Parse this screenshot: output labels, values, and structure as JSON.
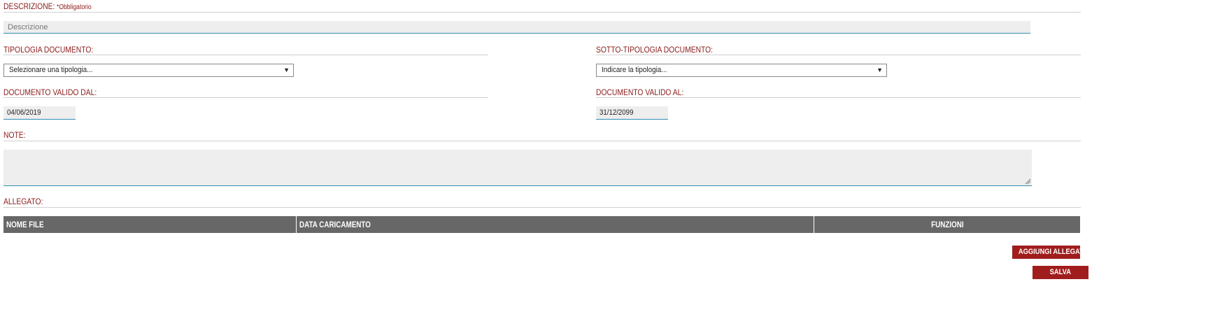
{
  "descrizione": {
    "label": "DESCRIZIONE:",
    "required": "*Obbligatorio",
    "placeholder": "Descrizione",
    "value": ""
  },
  "tipologia": {
    "label": "TIPOLOGIA DOCUMENTO:",
    "selected": "Selezionare una tipologia..."
  },
  "sotto_tipologia": {
    "label": "SOTTO-TIPOLOGIA DOCUMENTO:",
    "selected": "Indicare la tipologia..."
  },
  "valido_dal": {
    "label": "DOCUMENTO VALIDO DAL:",
    "value": "04/06/2019"
  },
  "valido_al": {
    "label": "DOCUMENTO VALIDO AL:",
    "value": "31/12/2099"
  },
  "note": {
    "label": "NOTE:",
    "value": ""
  },
  "allegato": {
    "label": "ALLEGATO:",
    "columns": [
      "NOME FILE",
      "DATA CARICAMENTO",
      "FUNZIONI"
    ]
  },
  "buttons": {
    "add_attachment": "AGGIUNGI ALLEGATO",
    "save": "SALVA"
  },
  "colors": {
    "label": "#8b1a1a",
    "button": "#a01d1d",
    "table_header": "#676767",
    "input_bg": "#eeeeee",
    "input_underline": "#2f8fb0"
  }
}
